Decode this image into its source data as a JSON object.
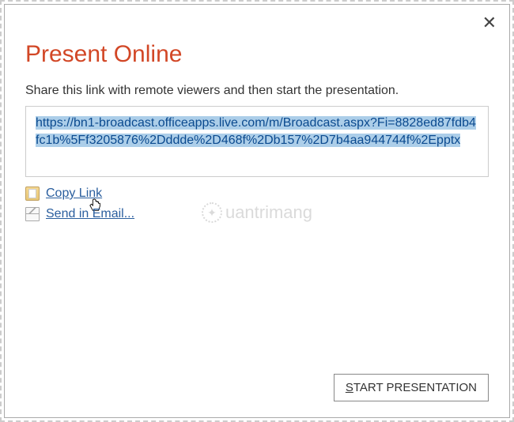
{
  "dialog": {
    "title": "Present Online",
    "instructions": "Share this link with remote viewers and then start the presentation.",
    "link_url": "https://bn1-broadcast.officeapps.live.com/m/Broadcast.aspx?Fi=8828ed87fdb4fc1b%5Ff3205876%2Dddde%2D468f%2Db157%2D7b4aa944744f%2Epptx",
    "actions": {
      "copy_link": "Copy Link",
      "send_email": "Send in Email..."
    },
    "start_button_prefix": "S",
    "start_button_rest": "TART PRESENTATION"
  },
  "watermark": "uantrimang"
}
